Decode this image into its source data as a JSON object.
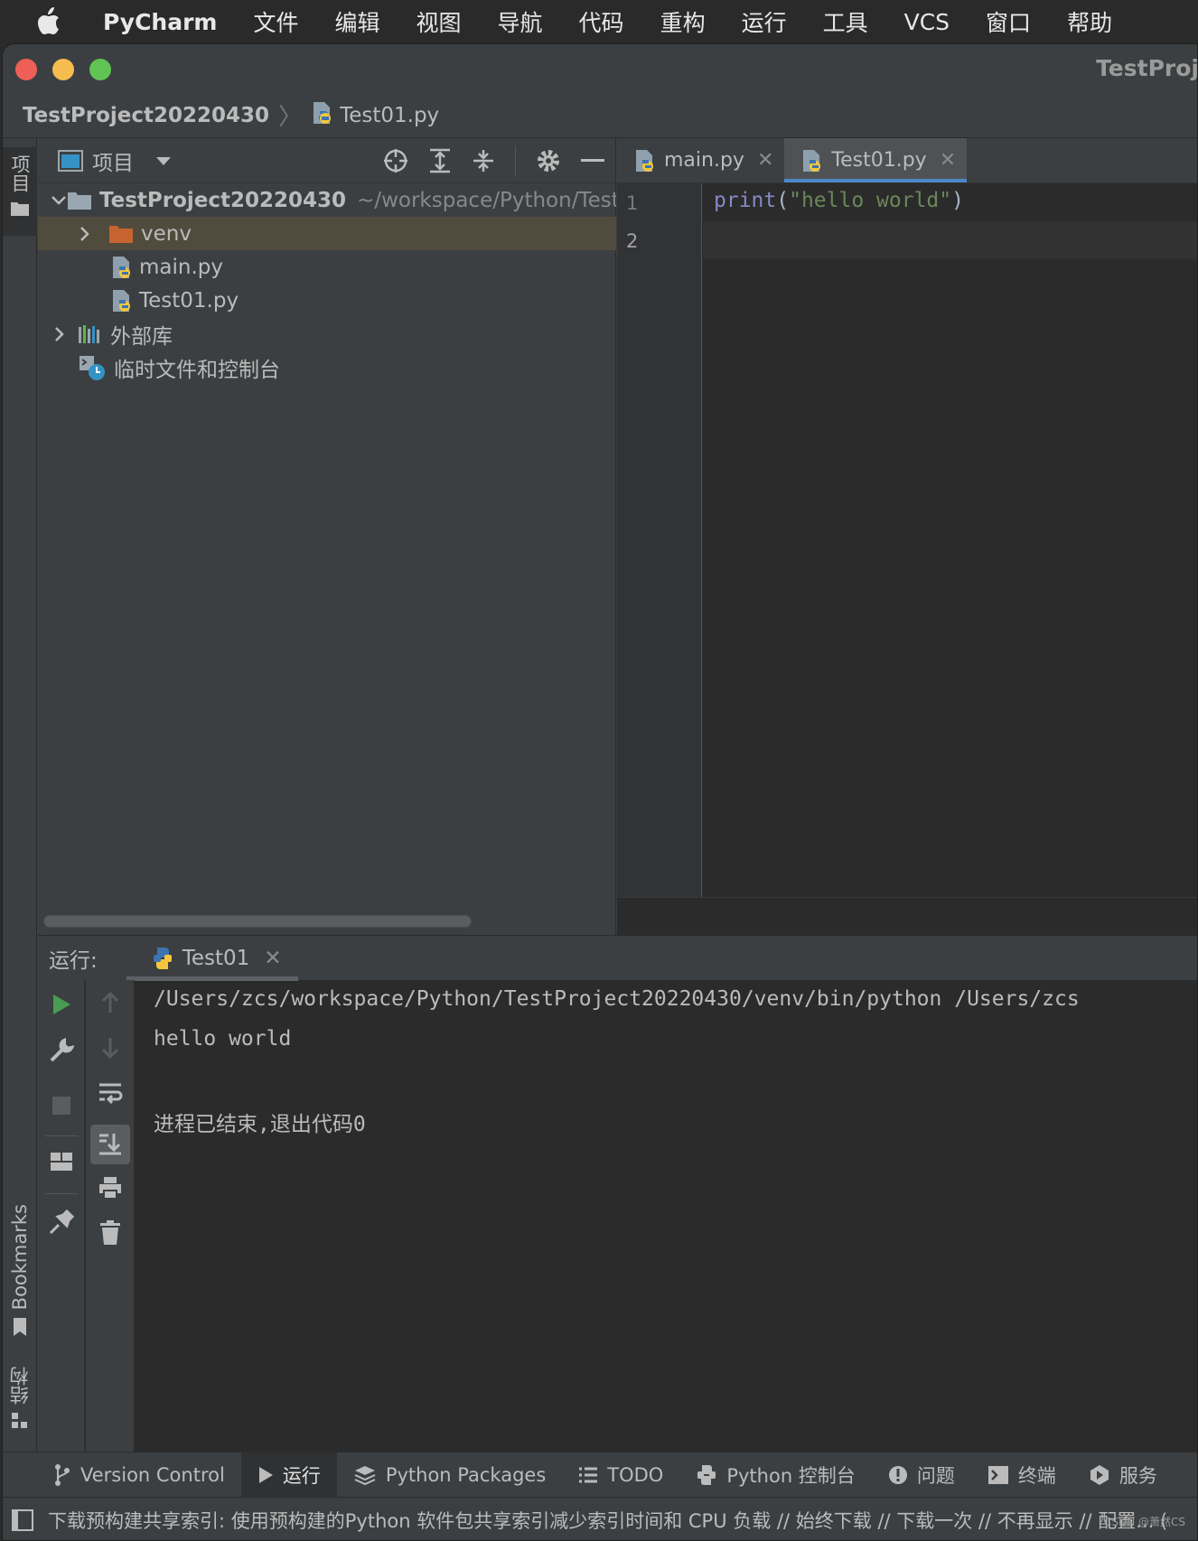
{
  "menubar": {
    "app_name": "PyCharm",
    "items": [
      "文件",
      "编辑",
      "视图",
      "导航",
      "代码",
      "重构",
      "运行",
      "工具",
      "VCS",
      "窗口",
      "帮助"
    ]
  },
  "window": {
    "title": "TestProj"
  },
  "navbar": {
    "project": "TestProject20220430",
    "file": "Test01.py"
  },
  "left_strip": {
    "project_tab": "项目",
    "bookmarks_tab": "Bookmarks",
    "structure_tab": "结构"
  },
  "project_panel": {
    "title": "项目",
    "tree": [
      {
        "label": "TestProject20220430",
        "path": "~/workspace/Python/Test",
        "kind": "root"
      },
      {
        "label": "venv",
        "kind": "folder",
        "selected": true
      },
      {
        "label": "main.py",
        "kind": "py"
      },
      {
        "label": "Test01.py",
        "kind": "py"
      },
      {
        "label": "外部库",
        "kind": "lib"
      },
      {
        "label": "临时文件和控制台",
        "kind": "scratch"
      }
    ]
  },
  "editor": {
    "tabs": [
      {
        "label": "main.py",
        "active": false
      },
      {
        "label": "Test01.py",
        "active": true
      }
    ],
    "line_numbers": [
      "1",
      "2"
    ],
    "code": {
      "fn": "print",
      "open": "(",
      "str": "\"hello world\"",
      "close": ")"
    }
  },
  "run_panel": {
    "label": "运行:",
    "tab": "Test01",
    "console": [
      "/Users/zcs/workspace/Python/TestProject20220430/venv/bin/python /Users/zcs",
      "hello world",
      "",
      "进程已结束,退出代码0"
    ]
  },
  "bottom_tabs": [
    "Version Control",
    "运行",
    "Python Packages",
    "TODO",
    "Python 控制台",
    "问题",
    "终端",
    "服务"
  ],
  "status": {
    "message": "下载预构建共享索引: 使用预构建的Python 软件包共享索引减少索引时间和 CPU 负载 // 始终下载 // 下载一次 // 不再显示 // 配置... ("
  },
  "watermark": "CSDN @萧然CS",
  "colors": {
    "accent": "#4a88c7",
    "run_green": "#499c54",
    "folder_orange": "#c5642f",
    "keyword": "#8888c6",
    "string": "#6a8759"
  }
}
